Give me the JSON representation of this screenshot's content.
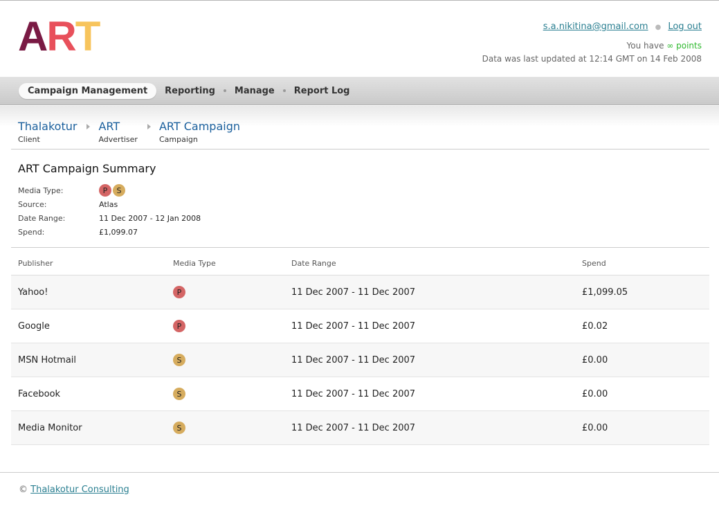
{
  "logo": {
    "l1": "A",
    "l2": "R",
    "l3": "T"
  },
  "account": {
    "email": "s.a.nikitina@gmail.com",
    "logout": "Log out",
    "points_prefix": "You have",
    "points_value": "∞ points",
    "updated": "Data was last updated at 12:14 GMT on 14 Feb 2008"
  },
  "nav": {
    "items": [
      "Campaign Management",
      "Reporting",
      "Manage",
      "Report Log"
    ]
  },
  "breadcrumb": [
    {
      "name": "Thalakotur",
      "type": "Client"
    },
    {
      "name": "ART",
      "type": "Advertiser"
    },
    {
      "name": "ART Campaign",
      "type": "Campaign"
    }
  ],
  "summary": {
    "title": "ART Campaign Summary",
    "media_type_label": "Media Type:",
    "media_types": [
      "P",
      "S"
    ],
    "source_label": "Source:",
    "source": "Atlas",
    "date_range_label": "Date Range:",
    "date_range": "11 Dec 2007 - 12 Jan 2008",
    "spend_label": "Spend:",
    "spend": "£1,099.07"
  },
  "table": {
    "headers": [
      "Publisher",
      "Media Type",
      "Date Range",
      "Spend"
    ],
    "rows": [
      {
        "publisher": "Yahoo!",
        "media": "P",
        "date": "11 Dec 2007 - 11 Dec 2007",
        "spend": "£1,099.05"
      },
      {
        "publisher": "Google",
        "media": "P",
        "date": "11 Dec 2007 - 11 Dec 2007",
        "spend": "£0.02"
      },
      {
        "publisher": "MSN Hotmail",
        "media": "S",
        "date": "11 Dec 2007 - 11 Dec 2007",
        "spend": "£0.00"
      },
      {
        "publisher": "Facebook",
        "media": "S",
        "date": "11 Dec 2007 - 11 Dec 2007",
        "spend": "£0.00"
      },
      {
        "publisher": "Media Monitor",
        "media": "S",
        "date": "11 Dec 2007 - 11 Dec 2007",
        "spend": "£0.00"
      }
    ]
  },
  "footer": {
    "copyright": "©",
    "company": "Thalakotur Consulting"
  },
  "colors": {
    "badge_p": "#d46565",
    "badge_s": "#d6ac5e",
    "link": "#1a5f9c",
    "points": "#2cb82c"
  }
}
